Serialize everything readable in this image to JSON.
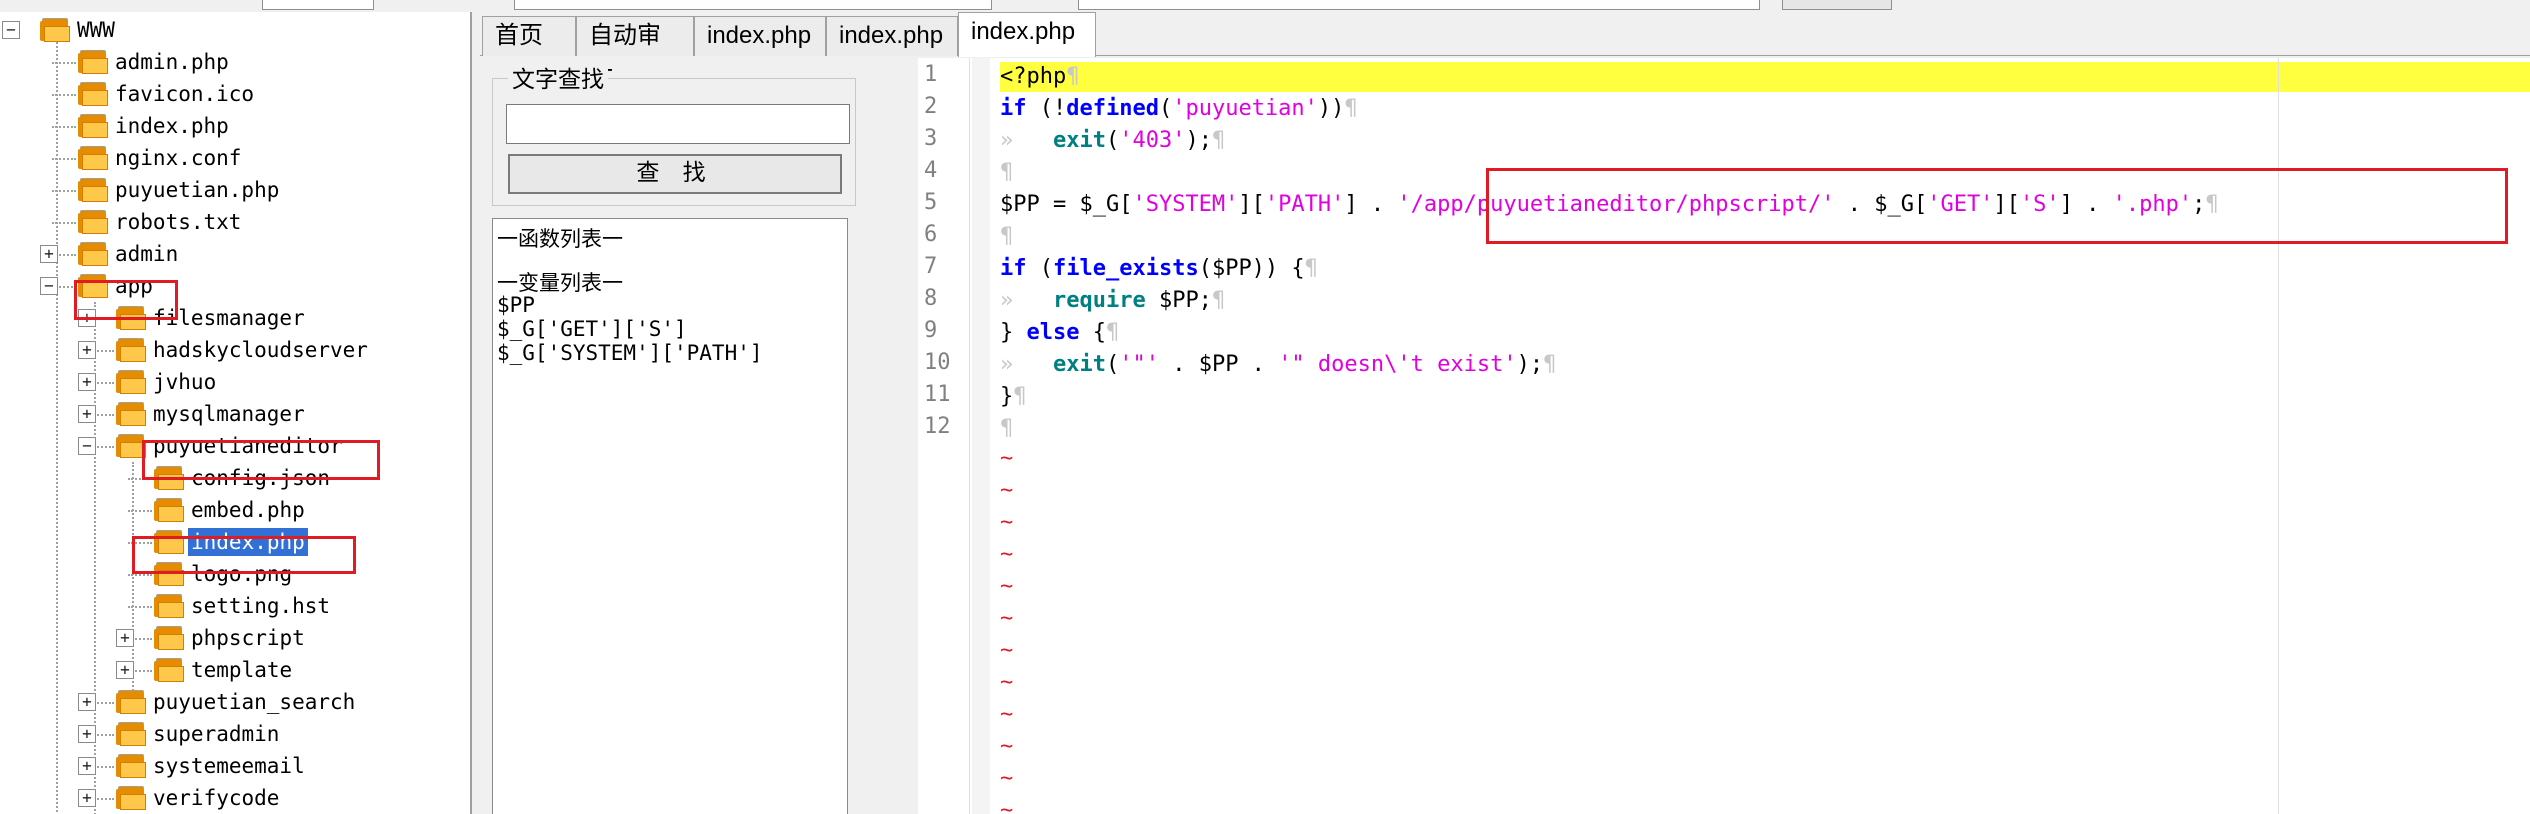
{
  "colors": {
    "highlight": "#ffff40",
    "keyword": "#0000ff",
    "function": "#008080",
    "string": "#e000e0",
    "annotation": "#e01b24",
    "selection": "#3370d6"
  },
  "tree": {
    "items": [
      {
        "label": "WWW",
        "type": "folder",
        "expander": "-"
      },
      {
        "label": "admin.php",
        "type": "file"
      },
      {
        "label": "favicon.ico",
        "type": "file"
      },
      {
        "label": "index.php",
        "type": "file"
      },
      {
        "label": "nginx.conf",
        "type": "file"
      },
      {
        "label": "puyuetian.php",
        "type": "file"
      },
      {
        "label": "robots.txt",
        "type": "file"
      },
      {
        "label": "admin",
        "type": "folder",
        "expander": "+"
      },
      {
        "label": "app",
        "type": "folder",
        "expander": "-"
      },
      {
        "label": "filesmanager",
        "type": "folder",
        "expander": "+"
      },
      {
        "label": "hadskycloudserver",
        "type": "folder",
        "expander": "+"
      },
      {
        "label": "jvhuo",
        "type": "folder",
        "expander": "+"
      },
      {
        "label": "mysqlmanager",
        "type": "folder",
        "expander": "+"
      },
      {
        "label": "puyuetianeditor",
        "type": "folder",
        "expander": "-"
      },
      {
        "label": "config.json",
        "type": "file"
      },
      {
        "label": "embed.php",
        "type": "file"
      },
      {
        "label": "index.php",
        "type": "file"
      },
      {
        "label": "logo.png",
        "type": "file"
      },
      {
        "label": "setting.hst",
        "type": "file"
      },
      {
        "label": "phpscript",
        "type": "folder",
        "expander": "+"
      },
      {
        "label": "template",
        "type": "folder",
        "expander": "+"
      },
      {
        "label": "puyuetian_search",
        "type": "folder",
        "expander": "+"
      },
      {
        "label": "superadmin",
        "type": "folder",
        "expander": "+"
      },
      {
        "label": "systemeemail",
        "type": "folder",
        "expander": "+"
      },
      {
        "label": "verifycode",
        "type": "folder",
        "expander": "+"
      }
    ]
  },
  "tabs": [
    "首页",
    "自动审计",
    "index.php",
    "index.php",
    "index.php"
  ],
  "search": {
    "title": "文字查找",
    "input_value": "",
    "button_label": "查 找"
  },
  "lists": {
    "functions_title": "一函数列表一",
    "variables_title": "一变量列表一",
    "variables": [
      "$PP",
      "$_G['GET']['S']",
      "$_G['SYSTEM']['PATH']"
    ]
  },
  "editor": {
    "line_numbers": [
      "1",
      "2",
      "3",
      "4",
      "5",
      "6",
      "7",
      "8",
      "9",
      "10",
      "11",
      "12"
    ],
    "lines": [
      [
        {
          "t": "<?php",
          "c": "ph"
        },
        {
          "t": "¶",
          "c": "ws"
        }
      ],
      [
        {
          "t": "if",
          "c": "kw"
        },
        {
          "t": " (!",
          "c": "var"
        },
        {
          "t": "defined",
          "c": "kw"
        },
        {
          "t": "(",
          "c": "var"
        },
        {
          "t": "'puyuetian'",
          "c": "str"
        },
        {
          "t": "))",
          "c": "var"
        },
        {
          "t": "¶",
          "c": "ws"
        }
      ],
      [
        {
          "t": "»   ",
          "c": "ws"
        },
        {
          "t": "exit",
          "c": "fn"
        },
        {
          "t": "(",
          "c": "var"
        },
        {
          "t": "'403'",
          "c": "str"
        },
        {
          "t": ");",
          "c": "var"
        },
        {
          "t": "¶",
          "c": "ws"
        }
      ],
      [
        {
          "t": "¶",
          "c": "ws"
        }
      ],
      [
        {
          "t": "$PP = $_G[",
          "c": "var"
        },
        {
          "t": "'SYSTEM'",
          "c": "str"
        },
        {
          "t": "][",
          "c": "var"
        },
        {
          "t": "'PATH'",
          "c": "str"
        },
        {
          "t": "] . ",
          "c": "var"
        },
        {
          "t": "'/app/puyuetianeditor/phpscript/'",
          "c": "str"
        },
        {
          "t": " . $_G[",
          "c": "var"
        },
        {
          "t": "'GET'",
          "c": "str"
        },
        {
          "t": "][",
          "c": "var"
        },
        {
          "t": "'S'",
          "c": "str"
        },
        {
          "t": "] . ",
          "c": "var"
        },
        {
          "t": "'.php'",
          "c": "str"
        },
        {
          "t": ";",
          "c": "var"
        },
        {
          "t": "¶",
          "c": "ws"
        }
      ],
      [
        {
          "t": "¶",
          "c": "ws"
        }
      ],
      [
        {
          "t": "if",
          "c": "kw"
        },
        {
          "t": " (",
          "c": "var"
        },
        {
          "t": "file_exists",
          "c": "kw"
        },
        {
          "t": "($PP)) {",
          "c": "var"
        },
        {
          "t": "¶",
          "c": "ws"
        }
      ],
      [
        {
          "t": "»   ",
          "c": "ws"
        },
        {
          "t": "require",
          "c": "fn"
        },
        {
          "t": " $PP;",
          "c": "var"
        },
        {
          "t": "¶",
          "c": "ws"
        }
      ],
      [
        {
          "t": "} ",
          "c": "var"
        },
        {
          "t": "else",
          "c": "kw"
        },
        {
          "t": " {",
          "c": "var"
        },
        {
          "t": "¶",
          "c": "ws"
        }
      ],
      [
        {
          "t": "»   ",
          "c": "ws"
        },
        {
          "t": "exit",
          "c": "fn"
        },
        {
          "t": "(",
          "c": "var"
        },
        {
          "t": "'\"'",
          "c": "str"
        },
        {
          "t": " . $PP . ",
          "c": "var"
        },
        {
          "t": "'\" doesn\\'t exist'",
          "c": "str"
        },
        {
          "t": ");",
          "c": "var"
        },
        {
          "t": "¶",
          "c": "ws"
        }
      ],
      [
        {
          "t": "}",
          "c": "var"
        },
        {
          "t": "¶",
          "c": "ws"
        }
      ],
      [
        {
          "t": "¶",
          "c": "ws"
        }
      ]
    ],
    "tilde": "~"
  }
}
